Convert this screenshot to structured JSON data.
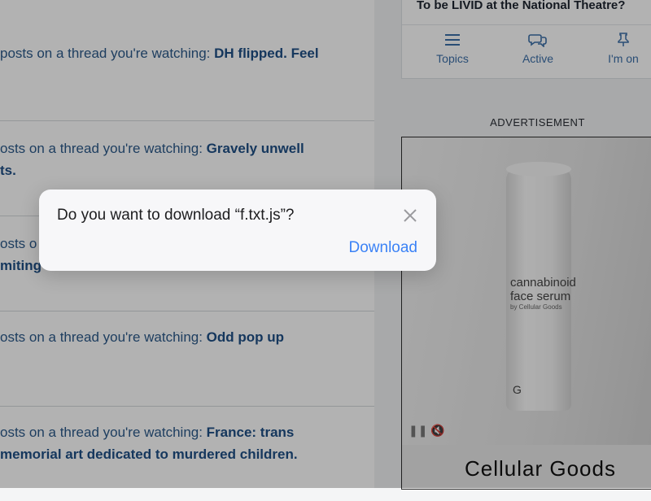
{
  "notifications": [
    {
      "prefix": "posts on a thread you're watching: ",
      "title_line1": "DH flipped. Feel",
      "title_line2": ""
    },
    {
      "prefix": "osts on a thread you're watching: ",
      "title_line1": "Gravely unwell",
      "title_line2": "ts."
    },
    {
      "prefix": "osts o",
      "title_line1": "",
      "title_line2": "miting"
    },
    {
      "prefix": "osts on a thread you're watching: ",
      "title_line1": "Odd pop up",
      "title_line2": ""
    },
    {
      "prefix": "osts on a thread you're watching: ",
      "title_line1": "France: trans",
      "title_line2": "memorial art dedicated to murdered children."
    }
  ],
  "sidebar": {
    "thread_title": "To be LIVID at the National Theatre?",
    "tabs": [
      {
        "label": "Topics",
        "icon": "menu-icon"
      },
      {
        "label": "Active",
        "icon": "chat-bubbles-icon"
      },
      {
        "label": "I'm on",
        "icon": "pin-icon"
      }
    ],
    "ad_label": "ADVERTISEMENT",
    "ad": {
      "product_name": "cannabinoid face serum",
      "product_by": "by Cellular Goods",
      "logo_glyph": "G",
      "brand": "Cellular Goods",
      "pause_glyph": "❚❚",
      "mute_glyph": "🔇"
    }
  },
  "dialog": {
    "message": "Do you want to download “f.txt.js”?",
    "download_label": "Download",
    "close_icon": "close-icon"
  },
  "colors": {
    "link_blue": "#1f4f86",
    "action_blue": "#3b82f6"
  }
}
